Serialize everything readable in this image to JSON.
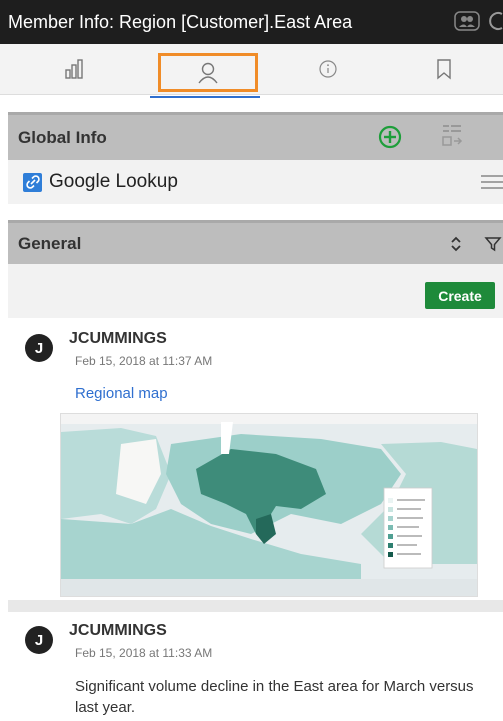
{
  "window": {
    "title": "Member Info: Region [Customer].East Area"
  },
  "tabs": [
    {
      "name": "chart-tab",
      "icon": "bar-chart-icon"
    },
    {
      "name": "person-tab",
      "icon": "person-icon",
      "active": true
    },
    {
      "name": "info-tab",
      "icon": "info-icon"
    },
    {
      "name": "bookmark-tab",
      "icon": "bookmark-icon"
    }
  ],
  "global_info": {
    "title": "Global Info",
    "items": [
      {
        "label": "Google Lookup",
        "icon": "link-icon"
      }
    ]
  },
  "general": {
    "title": "General",
    "create_label": "Create"
  },
  "comments": [
    {
      "avatar": "J",
      "author": "JCUMMINGS",
      "timestamp": "Feb 15, 2018 at 11:37 AM",
      "link": "Regional map",
      "attachment": "map-image"
    },
    {
      "avatar": "J",
      "author": "JCUMMINGS",
      "timestamp": "Feb 15, 2018 at 11:33 AM",
      "text": "Significant volume decline in the East area for March versus last year."
    }
  ],
  "colors": {
    "titlebar_bg": "#1e1e1e",
    "active_tab_border": "#f08c28",
    "create_button": "#1e8a3a",
    "add_icon": "#1e9e3a",
    "link": "#2f6fcf"
  }
}
